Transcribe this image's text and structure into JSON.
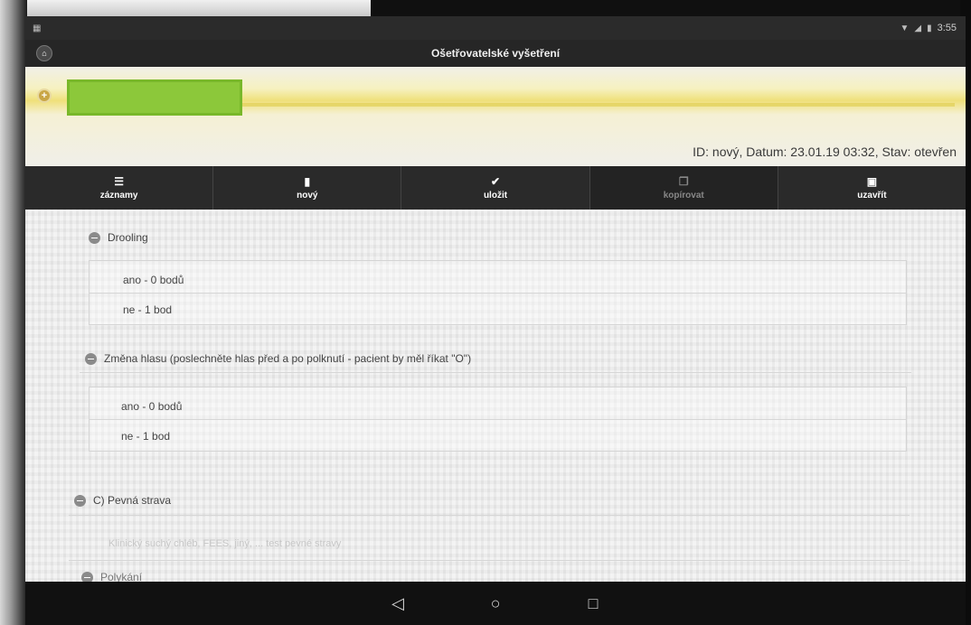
{
  "status": {
    "time": "3:55"
  },
  "window": {
    "title": "Ošetřovatelské vyšetření"
  },
  "patient": {
    "meta": "ID: nový, Datum: 23.01.19 03:32, Stav: otevřen"
  },
  "toolbar": [
    {
      "label": "záznamy",
      "icon": "list-icon"
    },
    {
      "label": "nový",
      "icon": "new-document-icon"
    },
    {
      "label": "uložit",
      "icon": "check-icon"
    },
    {
      "label": "kopírovat",
      "icon": "copy-icon"
    },
    {
      "label": "uzavřít",
      "icon": "lock-icon"
    }
  ],
  "sections": {
    "drooling": {
      "title": "Drooling",
      "options": [
        "ano - 0 bodů",
        "ne - 1 bod"
      ]
    },
    "voice": {
      "title": "Změna hlasu (poslechněte hlas před a po polknutí - pacient by měl říkat \"O\")",
      "options": [
        "ano - 0 bodů",
        "ne - 1 bod"
      ]
    },
    "solid": {
      "title": "C) Pevná strava"
    },
    "swallow": {
      "title": "Polykání"
    }
  },
  "faded_text": "Klinický suchý chléb, FEES, jiný, ... test pevné stravy",
  "colors": {
    "name_highlight": "#8cc83a",
    "banner_accent": "#efe07a",
    "toolbar_bg": "#2a2a2a"
  }
}
